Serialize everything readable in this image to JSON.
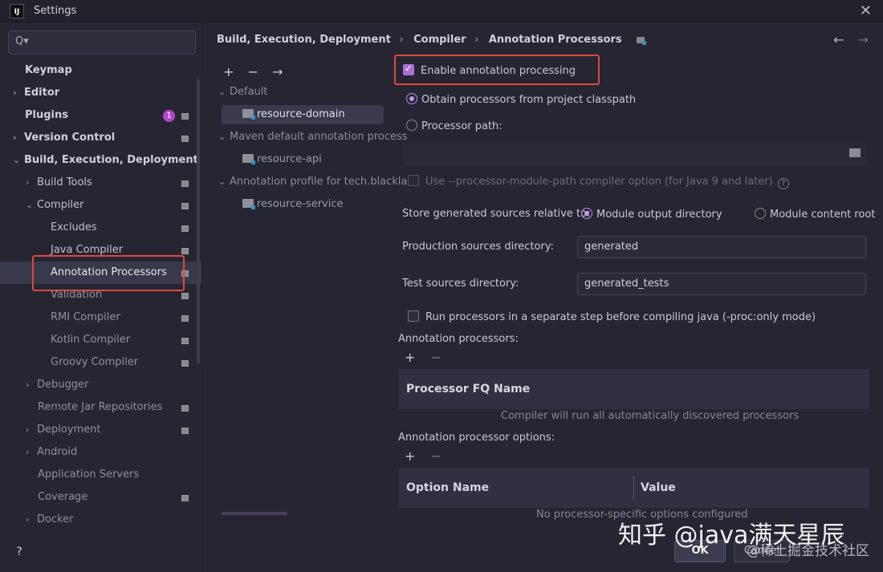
{
  "window": {
    "title": "Settings",
    "app_icon": "IJ",
    "close_icon": "✕"
  },
  "search": {
    "placeholder": "",
    "icon": "Q▾"
  },
  "sidebar": {
    "items": [
      {
        "label": "Keymap"
      },
      {
        "label": "Editor"
      },
      {
        "label": "Plugins",
        "badge": "1"
      },
      {
        "label": "Version Control"
      },
      {
        "label": "Build, Execution, Deployment"
      },
      {
        "label": "Build Tools"
      },
      {
        "label": "Compiler"
      },
      {
        "label": "Excludes"
      },
      {
        "label": "Java Compiler"
      },
      {
        "label": "Annotation Processors"
      },
      {
        "label": "Validation"
      },
      {
        "label": "RMI Compiler"
      },
      {
        "label": "Kotlin Compiler"
      },
      {
        "label": "Groovy Compiler"
      },
      {
        "label": "Debugger"
      },
      {
        "label": "Remote Jar Repositories"
      },
      {
        "label": "Deployment"
      },
      {
        "label": "Android"
      },
      {
        "label": "Application Servers"
      },
      {
        "label": "Coverage"
      },
      {
        "label": "Docker"
      }
    ],
    "help": "?"
  },
  "breadcrumb": {
    "items": [
      "Build, Execution, Deployment",
      "Compiler",
      "Annotation Processors"
    ],
    "separator": "›"
  },
  "nav": {
    "back": "←",
    "forward": "→"
  },
  "profiles": {
    "toolbar": {
      "add": "+",
      "remove": "−",
      "move": "→"
    },
    "items": [
      {
        "label": "Default"
      },
      {
        "label": "resource-domain"
      },
      {
        "label": "Maven default annotation process"
      },
      {
        "label": "resource-api"
      },
      {
        "label": "Annotation profile for tech.blackla"
      },
      {
        "label": "resource-service"
      }
    ]
  },
  "settings": {
    "enable_annotation_processing": "Enable annotation processing",
    "obtain_from_classpath": "Obtain processors from project classpath",
    "processor_path": "Processor path:",
    "processor_path_value": "",
    "module_path_option": "Use --processor-module-path compiler option (for Java 9 and later)",
    "store_generated_label": "Store generated sources relative to:",
    "module_output_directory": "Module output directory",
    "module_content_root": "Module content root",
    "production_sources_label": "Production sources directory:",
    "production_sources_value": "generated",
    "test_sources_label": "Test sources directory:",
    "test_sources_value": "generated_tests",
    "run_separate_step": "Run processors in a separate step before compiling java (-proc:only mode)",
    "annotation_processors_label": "Annotation processors:",
    "processor_fq_name_header": "Processor FQ Name",
    "processors_empty": "Compiler will run all automatically discovered processors",
    "processor_options_label": "Annotation processor options:",
    "option_name_header": "Option Name",
    "value_header": "Value",
    "options_empty": "No processor-specific options configured",
    "mini_add": "+",
    "mini_remove": "−"
  },
  "footer": {
    "ok": "OK",
    "cancel": "Cancel"
  },
  "watermark": {
    "main": "知乎 @java满天星辰",
    "sub": "@稀土掘金技术社区"
  },
  "colors": {
    "accent": "#a86ed9",
    "highlight_box": "#e0483a",
    "background": "#262633"
  }
}
